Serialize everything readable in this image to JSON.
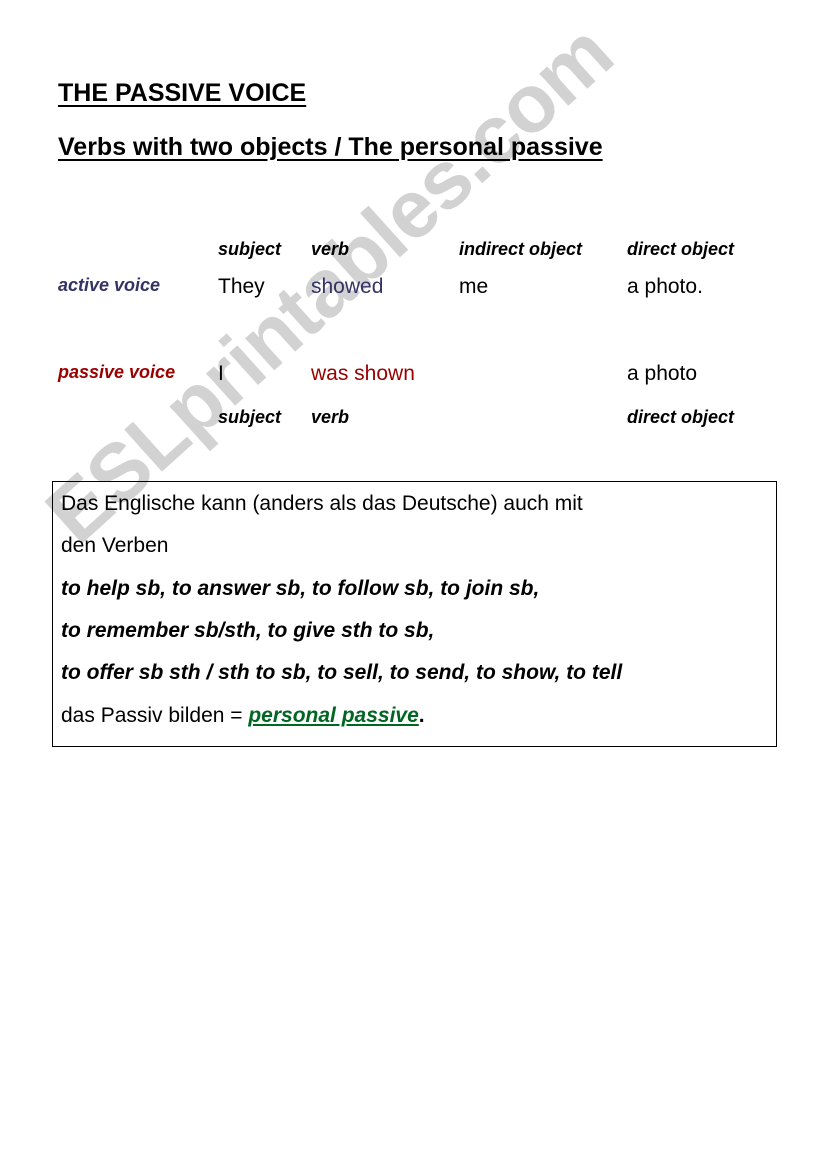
{
  "document": {
    "title": "THE PASSIVE VOICE",
    "subtitle": "Verbs with two objects / The personal passive"
  },
  "colors": {
    "active_voice": "#333366",
    "passive_voice": "#990000",
    "highlight_green": "#006622",
    "watermark": "#d2d2d2",
    "text": "#000000"
  },
  "table": {
    "top_headers": {
      "subject": "subject",
      "verb": "verb",
      "indirect_object": "indirect object",
      "direct_object": "direct object"
    },
    "active_row": {
      "label": "active voice",
      "subject": "They",
      "verb": "showed",
      "indirect_object": "me",
      "direct_object": "a photo."
    },
    "passive_row": {
      "label": "passive voice",
      "subject": "I",
      "verb": "was shown",
      "indirect_object": "",
      "direct_object": "a photo"
    },
    "bottom_headers": {
      "subject": "subject",
      "verb": "verb",
      "direct_object": "direct object"
    }
  },
  "note_box": {
    "line1": "Das Englische kann (anders als das Deutsche) auch mit",
    "line2": "den Verben",
    "line3": "to help sb, to answer sb, to follow sb, to join sb,",
    "line4": "to remember sb/sth, to give sth to sb,",
    "line5": "to offer sb sth / sth to sb, to sell, to send, to show, to tell",
    "line6_prefix": "das Passiv bilden = ",
    "line6_highlight": "personal passive",
    "line6_suffix": "."
  },
  "watermark": {
    "text": "ESLprintables.com"
  }
}
